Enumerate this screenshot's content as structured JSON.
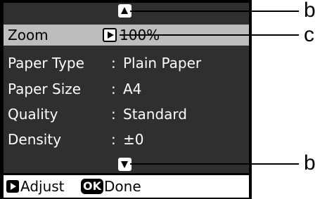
{
  "menu": {
    "rows": [
      {
        "label": "Zoom",
        "sep": "",
        "value": "100%",
        "selected": true
      },
      {
        "label": "Paper Type",
        "sep": ":",
        "value": "Plain Paper",
        "selected": false
      },
      {
        "label": "Paper Size",
        "sep": ":",
        "value": "A4",
        "selected": false
      },
      {
        "label": "Quality",
        "sep": ":",
        "value": "Standard",
        "selected": false
      },
      {
        "label": "Density",
        "sep": ":",
        "value": "±0",
        "selected": false
      }
    ]
  },
  "footer": {
    "adjust_label": "Adjust",
    "ok_label": "OK",
    "done_label": "Done"
  },
  "callouts": {
    "top": "b",
    "middle": "c",
    "bottom": "b"
  },
  "icons": {
    "scroll_up": "triangle-up-icon",
    "scroll_down": "triangle-down-icon",
    "adjust": "triangle-right-icon"
  }
}
